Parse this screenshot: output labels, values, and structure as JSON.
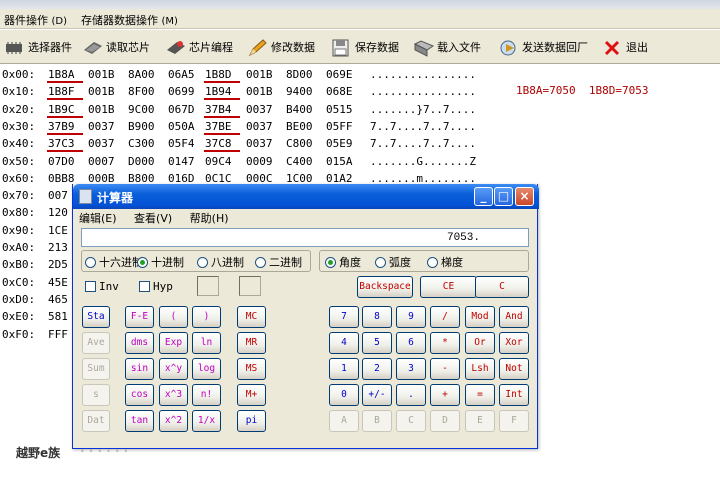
{
  "menubar": {
    "items": [
      {
        "label": "器件操作",
        "hotkey": "(D)"
      },
      {
        "label": "存储器数据操作",
        "hotkey": "(M)"
      }
    ]
  },
  "toolbar": {
    "buttons": [
      {
        "label": "选择器件",
        "icon": "chip-icon"
      },
      {
        "label": "读取芯片",
        "icon": "read-chip-icon"
      },
      {
        "label": "芯片编程",
        "icon": "program-chip-icon"
      },
      {
        "label": "修改数据",
        "icon": "edit-pencil-icon"
      },
      {
        "label": "保存数据",
        "icon": "save-disk-icon"
      },
      {
        "label": "载入文件",
        "icon": "load-file-icon"
      },
      {
        "label": "发送数据回厂",
        "icon": "send-data-icon"
      },
      {
        "label": "退出",
        "icon": "exit-x-icon"
      }
    ]
  },
  "hex_rows": [
    {
      "addr": "0x00:",
      "words": [
        "1B8A",
        "001B",
        "8A00",
        "06A5",
        "1B8D",
        "001B",
        "8D00",
        "069E"
      ],
      "ascii": "................"
    },
    {
      "addr": "0x10:",
      "words": [
        "1B8F",
        "001B",
        "8F00",
        "0699",
        "1B94",
        "001B",
        "9400",
        "068E"
      ],
      "ascii": "................"
    },
    {
      "addr": "0x20:",
      "words": [
        "1B9C",
        "001B",
        "9C00",
        "067D",
        "37B4",
        "0037",
        "B400",
        "0515"
      ],
      "ascii": ".......}7..7...."
    },
    {
      "addr": "0x30:",
      "words": [
        "37B9",
        "0037",
        "B900",
        "050A",
        "37BE",
        "0037",
        "BE00",
        "05FF"
      ],
      "ascii": "7..7....7..7...."
    },
    {
      "addr": "0x40:",
      "words": [
        "37C3",
        "0037",
        "C300",
        "05F4",
        "37C8",
        "0037",
        "C800",
        "05E9"
      ],
      "ascii": "7..7....7..7...."
    },
    {
      "addr": "0x50:",
      "words": [
        "07D0",
        "0007",
        "D000",
        "0147",
        "09C4",
        "0009",
        "C400",
        "015A"
      ],
      "ascii": ".......G.......Z"
    },
    {
      "addr": "0x60:",
      "words": [
        "0BB8",
        "000B",
        "B800",
        "016D",
        "0C1C",
        "000C",
        "1C00",
        "01A2"
      ],
      "ascii": ".......m........"
    },
    {
      "addr": "0x70:",
      "words": [
        "007"
      ],
      "ascii": ""
    },
    {
      "addr": "0x80:",
      "words": [
        "120"
      ],
      "ascii": ""
    },
    {
      "addr": "0x90:",
      "words": [
        "1CE"
      ],
      "ascii": ""
    },
    {
      "addr": "0xA0:",
      "words": [
        "213"
      ],
      "ascii": ""
    },
    {
      "addr": "0xB0:",
      "words": [
        "2D5"
      ],
      "ascii": ""
    },
    {
      "addr": "0xC0:",
      "words": [
        "45E"
      ],
      "ascii": ""
    },
    {
      "addr": "0xD0:",
      "words": [
        "465"
      ],
      "ascii": ""
    },
    {
      "addr": "0xE0:",
      "words": [
        "581"
      ],
      "ascii": ""
    },
    {
      "addr": "0xF0:",
      "words": [
        "FFF"
      ],
      "ascii": ""
    }
  ],
  "note": "1B8A=7050  1B8D=7053",
  "watermark": "越野e族",
  "calculator": {
    "title": "计算器",
    "menu": [
      "编辑(E)",
      "查看(V)",
      "帮助(H)"
    ],
    "display": "7053.",
    "bases": [
      {
        "label": "十六进制",
        "on": false
      },
      {
        "label": "十进制",
        "on": true
      },
      {
        "label": "八进制",
        "on": false
      },
      {
        "label": "二进制",
        "on": false
      }
    ],
    "angles": [
      {
        "label": "角度",
        "on": true
      },
      {
        "label": "弧度",
        "on": false
      },
      {
        "label": "梯度",
        "on": false
      }
    ],
    "checks": [
      "Inv",
      "Hyp"
    ],
    "edit_buttons": [
      "Backspace",
      "CE",
      "C"
    ],
    "sci_col1": [
      "Sta",
      "Ave",
      "Sum",
      "s",
      "Dat"
    ],
    "sci_rows": [
      [
        "F-E",
        "(",
        ")"
      ],
      [
        "dms",
        "Exp",
        "ln"
      ],
      [
        "sin",
        "x^y",
        "log"
      ],
      [
        "cos",
        "x^3",
        "n!"
      ],
      [
        "tan",
        "x^2",
        "1/x"
      ]
    ],
    "mem": [
      "MC",
      "MR",
      "MS",
      "M+",
      "pi"
    ],
    "keypad": [
      [
        "7",
        "8",
        "9",
        "/",
        "Mod",
        "And"
      ],
      [
        "4",
        "5",
        "6",
        "*",
        "Or",
        "Xor"
      ],
      [
        "1",
        "2",
        "3",
        "-",
        "Lsh",
        "Not"
      ],
      [
        "0",
        "+/-",
        ".",
        "+",
        "=",
        "Int"
      ],
      [
        "A",
        "B",
        "C",
        "D",
        "E",
        "F"
      ]
    ]
  }
}
